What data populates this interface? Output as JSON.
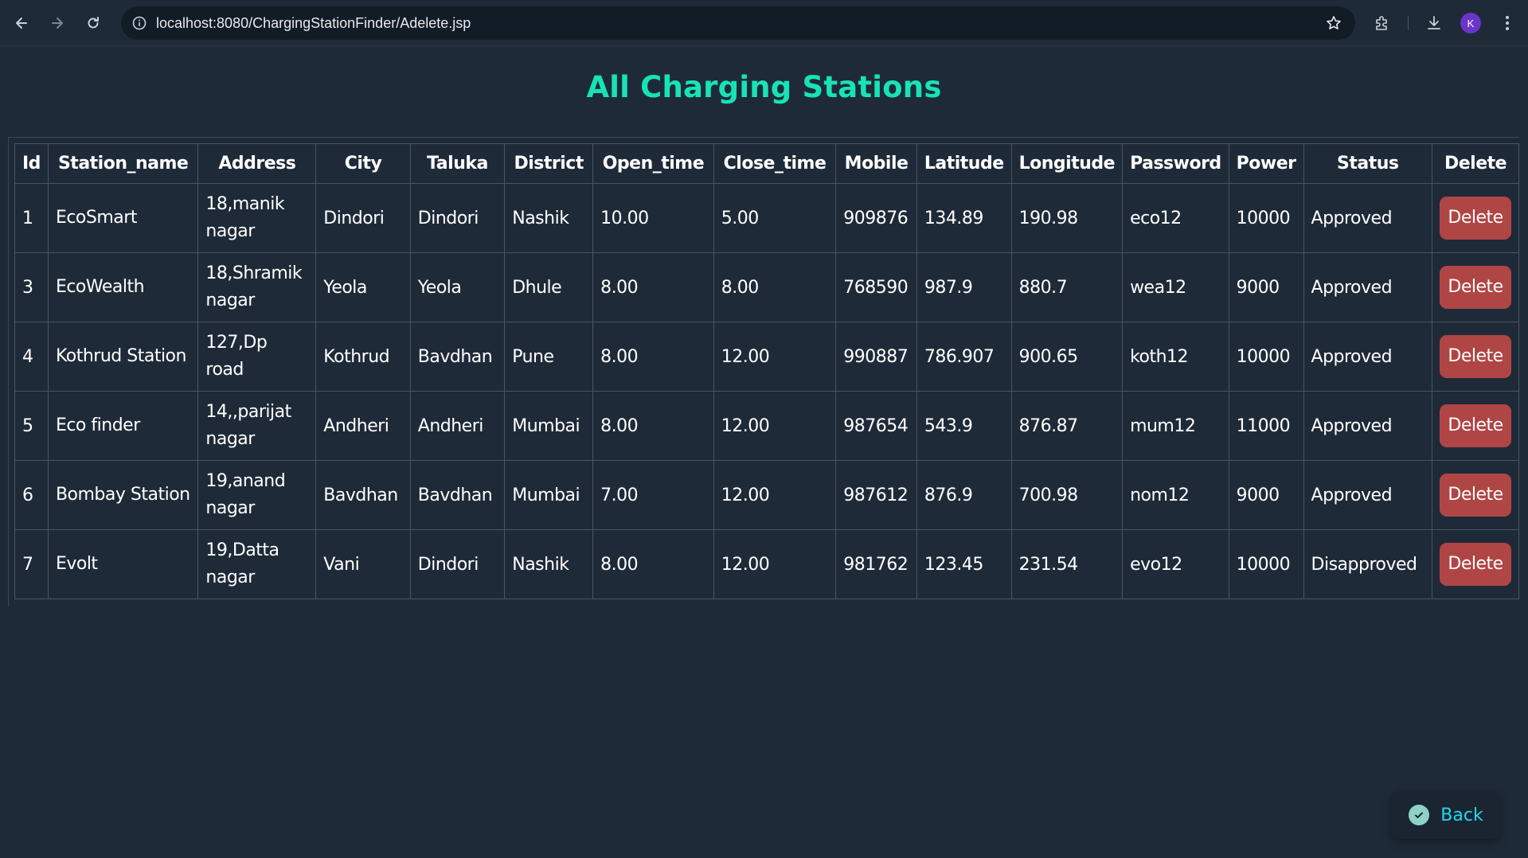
{
  "browser": {
    "url": "localhost:8080/ChargingStationFinder/Adelete.jsp",
    "profile_initial": "K"
  },
  "page": {
    "title": "All Charging Stations",
    "back_label": "Back"
  },
  "table": {
    "headers": [
      "Id",
      "Station_name",
      "Address",
      "City",
      "Taluka",
      "District",
      "Open_time",
      "Close_time",
      "Mobile",
      "Latitude",
      "Longitude",
      "Password",
      "Power",
      "Status",
      "Delete"
    ],
    "rows": [
      {
        "id": "1",
        "name": "EcoSmart",
        "address": "18,manik nagar",
        "city": "Dindori",
        "taluka": "Dindori",
        "district": "Nashik",
        "open": "10.00",
        "close": "5.00",
        "mobile": "909876",
        "lat": "134.89",
        "lon": "190.98",
        "password": "eco12",
        "power": "10000",
        "status": "Approved",
        "delete": "Delete"
      },
      {
        "id": "3",
        "name": "EcoWealth",
        "address": "18,Shramik nagar",
        "city": "Yeola",
        "taluka": "Yeola",
        "district": "Dhule",
        "open": "8.00",
        "close": "8.00",
        "mobile": "768590",
        "lat": "987.9",
        "lon": "880.7",
        "password": "wea12",
        "power": "9000",
        "status": "Approved",
        "delete": "Delete"
      },
      {
        "id": "4",
        "name": "Kothrud Station",
        "address": "127,Dp road",
        "city": "Kothrud",
        "taluka": "Bavdhan",
        "district": "Pune",
        "open": "8.00",
        "close": "12.00",
        "mobile": "990887",
        "lat": "786.907",
        "lon": "900.65",
        "password": "koth12",
        "power": "10000",
        "status": "Approved",
        "delete": "Delete"
      },
      {
        "id": "5",
        "name": "Eco finder",
        "address": "14,,parijat nagar",
        "city": "Andheri",
        "taluka": "Andheri",
        "district": "Mumbai",
        "open": "8.00",
        "close": "12.00",
        "mobile": "987654",
        "lat": "543.9",
        "lon": "876.87",
        "password": "mum12",
        "power": "11000",
        "status": "Approved",
        "delete": "Delete"
      },
      {
        "id": "6",
        "name": "Bombay Station",
        "address": "19,anand nagar",
        "city": "Bavdhan",
        "taluka": "Bavdhan",
        "district": "Mumbai",
        "open": "7.00",
        "close": "12.00",
        "mobile": "987612",
        "lat": "876.9",
        "lon": "700.98",
        "password": "nom12",
        "power": "9000",
        "status": "Approved",
        "delete": "Delete"
      },
      {
        "id": "7",
        "name": "Evolt",
        "address": "19,Datta nagar",
        "city": "Vani",
        "taluka": "Dindori",
        "district": "Nashik",
        "open": "8.00",
        "close": "12.00",
        "mobile": "981762",
        "lat": "123.45",
        "lon": "231.54",
        "password": "evo12",
        "power": "10000",
        "status": "Disapproved",
        "delete": "Delete"
      }
    ]
  },
  "colors": {
    "background": "#1f2a38",
    "title": "#17e3b6",
    "delete_button": "#b04545",
    "back_text": "#22d8ea"
  }
}
